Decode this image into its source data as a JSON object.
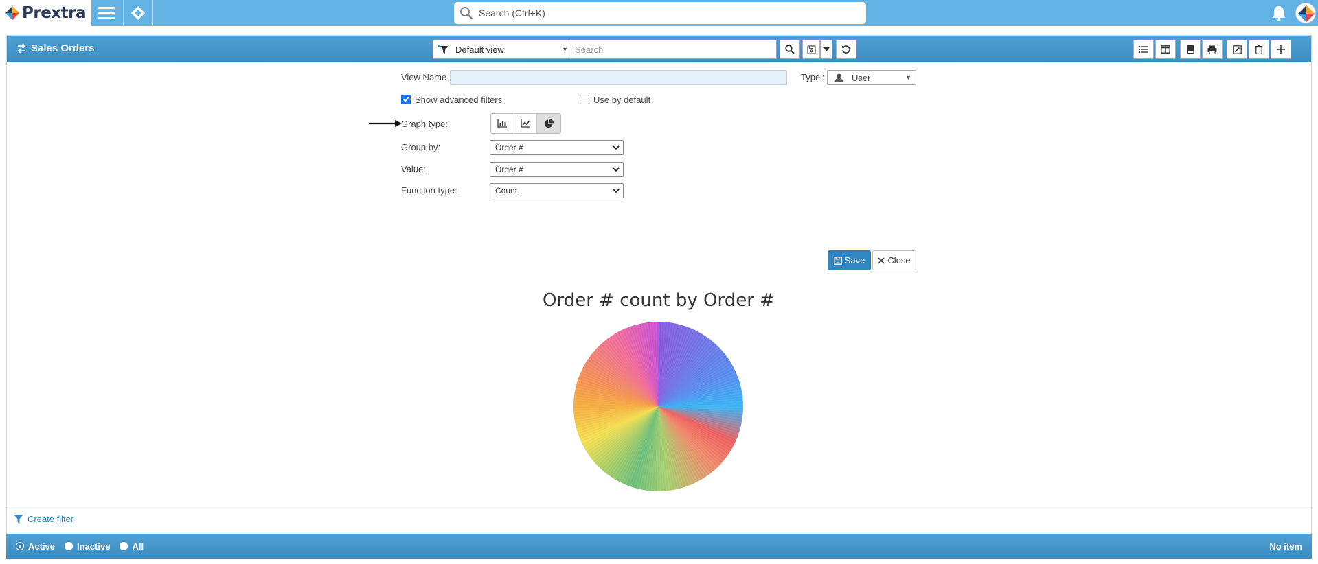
{
  "app": {
    "name": "Prextra"
  },
  "topbar": {
    "search_placeholder": "Search (Ctrl+K)",
    "icons": [
      "hamburger-menu-icon",
      "prextra-diamond-icon",
      "bell-icon",
      "avatar"
    ]
  },
  "panel": {
    "title": "Sales Orders",
    "view_selector": {
      "value": "Default view"
    },
    "search_placeholder": "Search"
  },
  "form": {
    "view_name_label": "View Name :",
    "view_name_value": "",
    "type_label": "Type :",
    "type_value": "User",
    "show_advanced_filters": {
      "label": "Show advanced filters",
      "checked": true
    },
    "use_by_default": {
      "label": "Use by default",
      "checked": false
    },
    "graph_type_label": "Graph type:",
    "graph_type_selected": "pie",
    "group_by_label": "Group by:",
    "group_by_value": "Order #",
    "value_label": "Value:",
    "value_value": "Order #",
    "function_type_label": "Function type:",
    "function_type_value": "Count",
    "save_label": "Save",
    "close_label": "Close"
  },
  "chart_data": {
    "type": "pie",
    "title": "Order # count by Order #",
    "xlabel": "",
    "ylabel": ""
  },
  "footer": {
    "create_filter_label": "Create filter",
    "status_options": [
      {
        "label": "Active",
        "selected": true
      },
      {
        "label": "Inactive",
        "selected": false
      },
      {
        "label": "All",
        "selected": false
      }
    ],
    "count_text": "No item"
  },
  "colors": {
    "topbar": "#62b2e4",
    "panel_header": "#3d8cc0",
    "accent": "#2f86c2"
  }
}
